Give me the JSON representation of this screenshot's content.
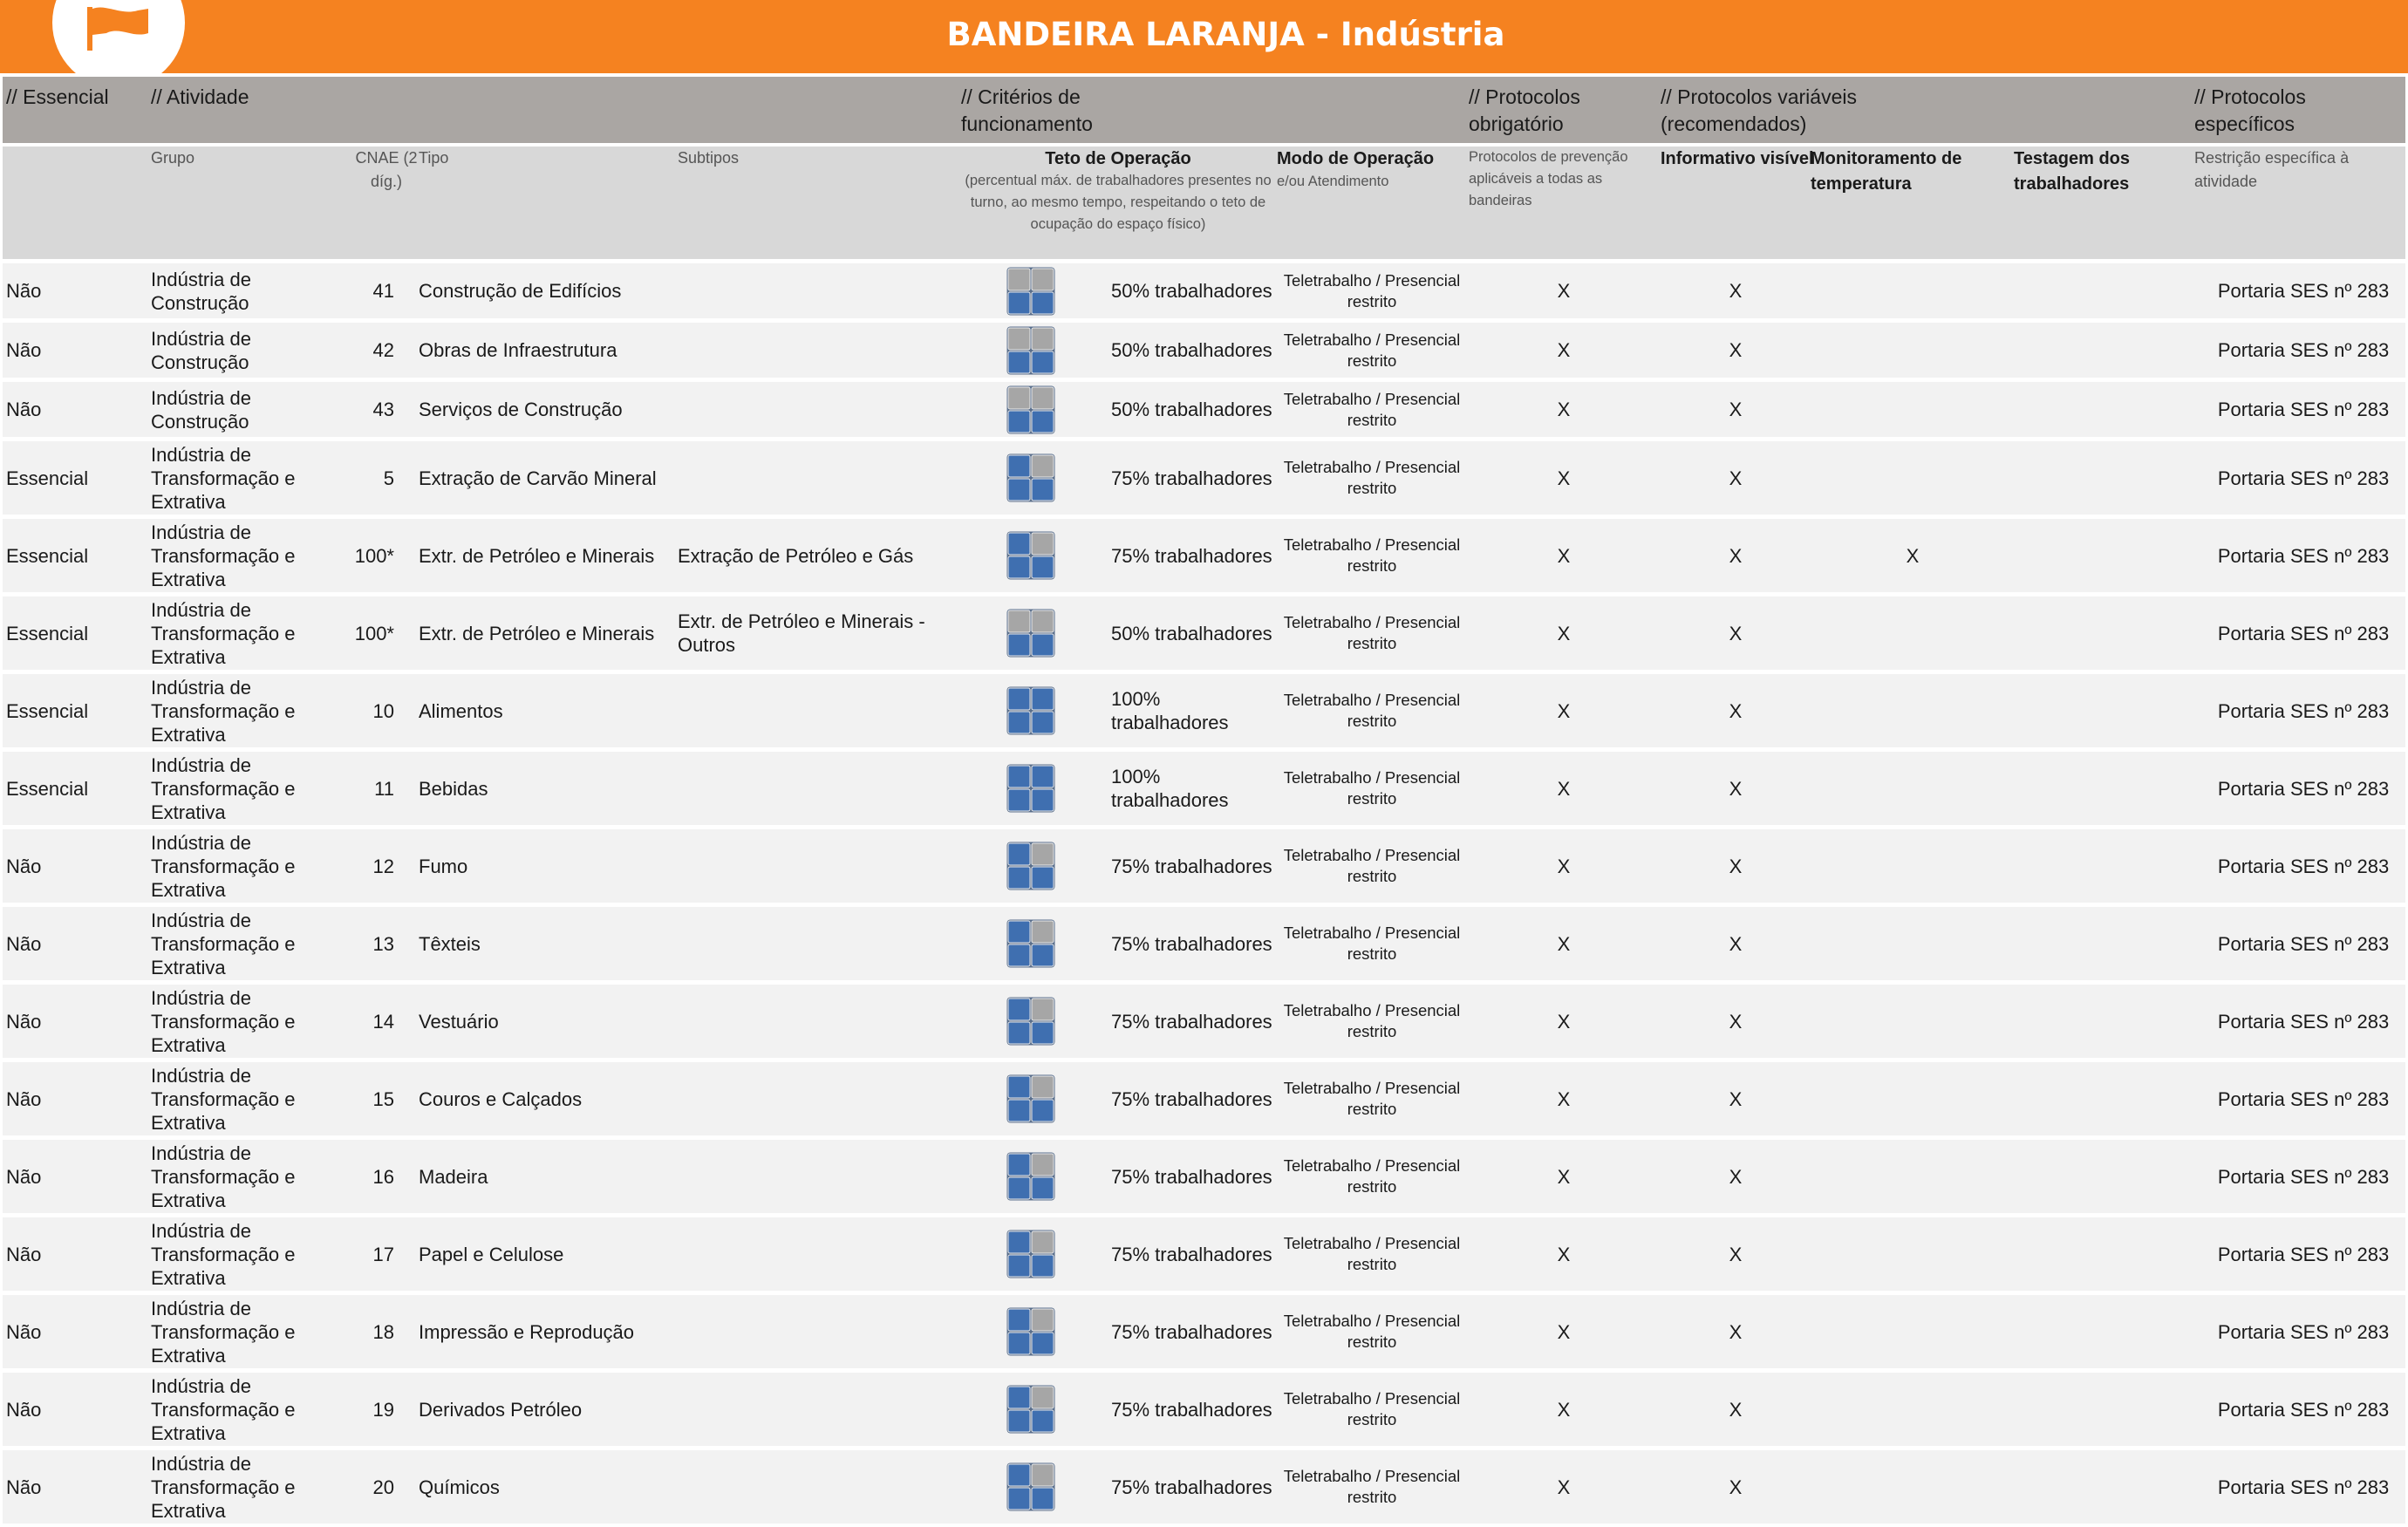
{
  "banner": {
    "title": "BANDEIRA LARANJA - Indústria"
  },
  "colors": {
    "orange": "#f58220",
    "icon_blue": "#3f6fb0",
    "icon_gray": "#a6a6a6"
  },
  "sections": {
    "essencial": "// Essencial",
    "atividade": "// Atividade",
    "criterios": "// Critérios de funcionamento",
    "obrigatorio": "// Protocolos obrigatório",
    "variaveis": "// Protocolos variáveis (recomendados)",
    "especificos": "// Protocolos específicos"
  },
  "subheaders": {
    "grupo": "Grupo",
    "cnae": "CNAE (2 díg.)",
    "tipo": "Tipo",
    "subtipos": "Subtipos",
    "teto": "Teto de Operação",
    "teto_desc": "(percentual máx. de trabalhadores presentes no turno, ao mesmo tempo, respeitando o teto de ocupação do espaço físico)",
    "modo": "Modo de Operação",
    "modo_desc": "e/ou Atendimento",
    "prevencao": "Protocolos de prevenção aplicáveis a todas as bandeiras",
    "informativo": "Informativo visível",
    "monitoramento": "Monitoramento de temperatura",
    "testagem": "Testagem dos trabalhadores",
    "restricao": "Restrição específica à atividade"
  },
  "rows": [
    {
      "essencial": "Não",
      "grupo": "Indústria de Construção",
      "cnae": "41",
      "tipo": "Construção de Edifícios",
      "subtipo": "",
      "icon": "half",
      "teto": "50% trabalhadores",
      "modo": "Teletrabalho / Presencial restrito",
      "prevencao": "X",
      "informativo": "X",
      "monitoramento": "",
      "testagem": "",
      "restricao": "Portaria SES nº 283"
    },
    {
      "essencial": "Não",
      "grupo": "Indústria de Construção",
      "cnae": "42",
      "tipo": "Obras de Infraestrutura",
      "subtipo": "",
      "icon": "half",
      "teto": "50% trabalhadores",
      "modo": "Teletrabalho / Presencial restrito",
      "prevencao": "X",
      "informativo": "X",
      "monitoramento": "",
      "testagem": "",
      "restricao": "Portaria SES nº 283"
    },
    {
      "essencial": "Não",
      "grupo": "Indústria de Construção",
      "cnae": "43",
      "tipo": "Serviços de Construção",
      "subtipo": "",
      "icon": "half",
      "teto": "50% trabalhadores",
      "modo": "Teletrabalho / Presencial restrito",
      "prevencao": "X",
      "informativo": "X",
      "monitoramento": "",
      "testagem": "",
      "restricao": "Portaria SES nº 283"
    },
    {
      "essencial": "Essencial",
      "grupo": "Indústria de Transformação e Extrativa",
      "cnae": "5",
      "tipo": "Extração de Carvão Mineral",
      "subtipo": "",
      "icon": "three",
      "teto": "75% trabalhadores",
      "modo": "Teletrabalho / Presencial restrito",
      "prevencao": "X",
      "informativo": "X",
      "monitoramento": "",
      "testagem": "",
      "restricao": "Portaria SES nº 283"
    },
    {
      "essencial": "Essencial",
      "grupo": "Indústria de Transformação e Extrativa",
      "cnae": "100*",
      "tipo": "Extr. de Petróleo e Minerais",
      "subtipo": "Extração de Petróleo e Gás",
      "icon": "three",
      "teto": "75% trabalhadores",
      "modo": "Teletrabalho / Presencial restrito",
      "prevencao": "X",
      "informativo": "X",
      "monitoramento": "X",
      "testagem": "",
      "restricao": "Portaria SES nº 283"
    },
    {
      "essencial": "Essencial",
      "grupo": "Indústria de Transformação e Extrativa",
      "cnae": "100*",
      "tipo": "Extr. de Petróleo e Minerais",
      "subtipo": "Extr. de Petróleo e Minerais - Outros",
      "icon": "half",
      "teto": "50% trabalhadores",
      "modo": "Teletrabalho / Presencial restrito",
      "prevencao": "X",
      "informativo": "X",
      "monitoramento": "",
      "testagem": "",
      "restricao": "Portaria SES nº 283"
    },
    {
      "essencial": "Essencial",
      "grupo": "Indústria de Transformação e Extrativa",
      "cnae": "10",
      "tipo": "Alimentos",
      "subtipo": "",
      "icon": "full",
      "teto": "100% trabalhadores",
      "modo": "Teletrabalho / Presencial restrito",
      "prevencao": "X",
      "informativo": "X",
      "monitoramento": "",
      "testagem": "",
      "restricao": "Portaria SES nº 283"
    },
    {
      "essencial": "Essencial",
      "grupo": "Indústria de Transformação e Extrativa",
      "cnae": "11",
      "tipo": "Bebidas",
      "subtipo": "",
      "icon": "full",
      "teto": "100% trabalhadores",
      "modo": "Teletrabalho / Presencial restrito",
      "prevencao": "X",
      "informativo": "X",
      "monitoramento": "",
      "testagem": "",
      "restricao": "Portaria SES nº 283"
    },
    {
      "essencial": "Não",
      "grupo": "Indústria de Transformação e Extrativa",
      "cnae": "12",
      "tipo": "Fumo",
      "subtipo": "",
      "icon": "three",
      "teto": "75% trabalhadores",
      "modo": "Teletrabalho / Presencial restrito",
      "prevencao": "X",
      "informativo": "X",
      "monitoramento": "",
      "testagem": "",
      "restricao": "Portaria SES nº 283"
    },
    {
      "essencial": "Não",
      "grupo": "Indústria de Transformação e Extrativa",
      "cnae": "13",
      "tipo": "Têxteis",
      "subtipo": "",
      "icon": "three",
      "teto": "75% trabalhadores",
      "modo": "Teletrabalho / Presencial restrito",
      "prevencao": "X",
      "informativo": "X",
      "monitoramento": "",
      "testagem": "",
      "restricao": "Portaria SES nº 283"
    },
    {
      "essencial": "Não",
      "grupo": "Indústria de Transformação e Extrativa",
      "cnae": "14",
      "tipo": "Vestuário",
      "subtipo": "",
      "icon": "three",
      "teto": "75% trabalhadores",
      "modo": "Teletrabalho / Presencial restrito",
      "prevencao": "X",
      "informativo": "X",
      "monitoramento": "",
      "testagem": "",
      "restricao": "Portaria SES nº 283"
    },
    {
      "essencial": "Não",
      "grupo": "Indústria de Transformação e Extrativa",
      "cnae": "15",
      "tipo": "Couros e Calçados",
      "subtipo": "",
      "icon": "three",
      "teto": "75% trabalhadores",
      "modo": "Teletrabalho / Presencial restrito",
      "prevencao": "X",
      "informativo": "X",
      "monitoramento": "",
      "testagem": "",
      "restricao": "Portaria SES nº 283"
    },
    {
      "essencial": "Não",
      "grupo": "Indústria de Transformação e Extrativa",
      "cnae": "16",
      "tipo": "Madeira",
      "subtipo": "",
      "icon": "three",
      "teto": "75% trabalhadores",
      "modo": "Teletrabalho / Presencial restrito",
      "prevencao": "X",
      "informativo": "X",
      "monitoramento": "",
      "testagem": "",
      "restricao": "Portaria SES nº 283"
    },
    {
      "essencial": "Não",
      "grupo": "Indústria de Transformação e Extrativa",
      "cnae": "17",
      "tipo": "Papel e Celulose",
      "subtipo": "",
      "icon": "three",
      "teto": "75% trabalhadores",
      "modo": "Teletrabalho / Presencial restrito",
      "prevencao": "X",
      "informativo": "X",
      "monitoramento": "",
      "testagem": "",
      "restricao": "Portaria SES nº 283"
    },
    {
      "essencial": "Não",
      "grupo": "Indústria de Transformação e Extrativa",
      "cnae": "18",
      "tipo": "Impressão e Reprodução",
      "subtipo": "",
      "icon": "three",
      "teto": "75% trabalhadores",
      "modo": "Teletrabalho / Presencial restrito",
      "prevencao": "X",
      "informativo": "X",
      "monitoramento": "",
      "testagem": "",
      "restricao": "Portaria SES nº 283"
    },
    {
      "essencial": "Não",
      "grupo": "Indústria de Transformação e Extrativa",
      "cnae": "19",
      "tipo": "Derivados Petróleo",
      "subtipo": "",
      "icon": "three",
      "teto": "75% trabalhadores",
      "modo": "Teletrabalho / Presencial restrito",
      "prevencao": "X",
      "informativo": "X",
      "monitoramento": "",
      "testagem": "",
      "restricao": "Portaria SES nº 283"
    },
    {
      "essencial": "Não",
      "grupo": "Indústria de Transformação e Extrativa",
      "cnae": "20",
      "tipo": "Químicos",
      "subtipo": "",
      "icon": "three",
      "teto": "75% trabalhadores",
      "modo": "Teletrabalho / Presencial restrito",
      "prevencao": "X",
      "informativo": "X",
      "monitoramento": "",
      "testagem": "",
      "restricao": "Portaria SES nº 283"
    }
  ]
}
